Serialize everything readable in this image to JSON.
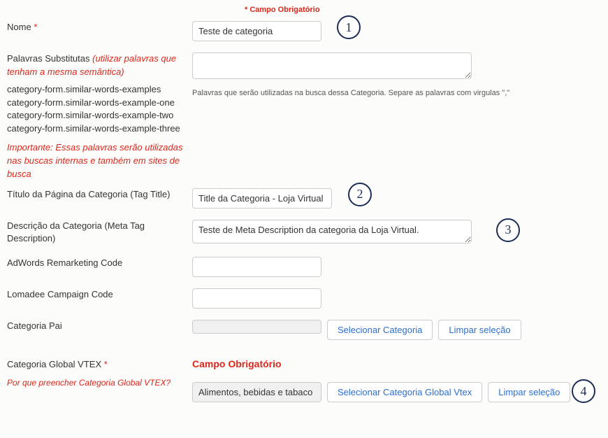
{
  "header": {
    "required_note": "* Campo Obrigatório"
  },
  "fields": {
    "name": {
      "label": "Nome",
      "value": "Teste de categoria"
    },
    "substitute_words": {
      "label": "Palavras Substitutas",
      "hint": "(utilizar palavras que tenham a mesma semântica)",
      "lines": [
        "category-form.similar-words-examples",
        "category-form.similar-words-example-one",
        "category-form.similar-words-example-two",
        "category-form.similar-words-example-three"
      ],
      "important": "Importante: Essas palavras serão utilizadas nas buscas internas e também em sites de busca",
      "value": "",
      "help": "Palavras que serão utilizadas na busca dessa Categoria. Separe as palavras com virgulas \",\""
    },
    "page_title": {
      "label": "Título da Página da Categoria (Tag Title)",
      "value": "Title da Categoria - Loja Virtual"
    },
    "meta_desc": {
      "label": "Descrição da Categoria (Meta Tag Description)",
      "value": "Teste de Meta Description da categoria da Loja Virtual."
    },
    "adwords": {
      "label": "AdWords Remarketing Code",
      "value": ""
    },
    "lomadee": {
      "label": "Lomadee Campaign Code",
      "value": ""
    },
    "parent_cat": {
      "label": "Categoria Pai",
      "value": "",
      "select_btn": "Selecionar Categoria",
      "clear_btn": "Limpar seleção"
    },
    "global_vtex": {
      "label": "Categoria Global VTEX",
      "why": "Por que preencher Categoria Global VTEX?",
      "required_msg": "Campo Obrigatório",
      "value": "Alimentos, bebidas e tabaco",
      "select_btn": "Selecionar Categoria Global Vtex",
      "clear_btn": "Limpar seleção"
    }
  },
  "callouts": {
    "n1": "1",
    "n2": "2",
    "n3": "3",
    "n4": "4"
  }
}
